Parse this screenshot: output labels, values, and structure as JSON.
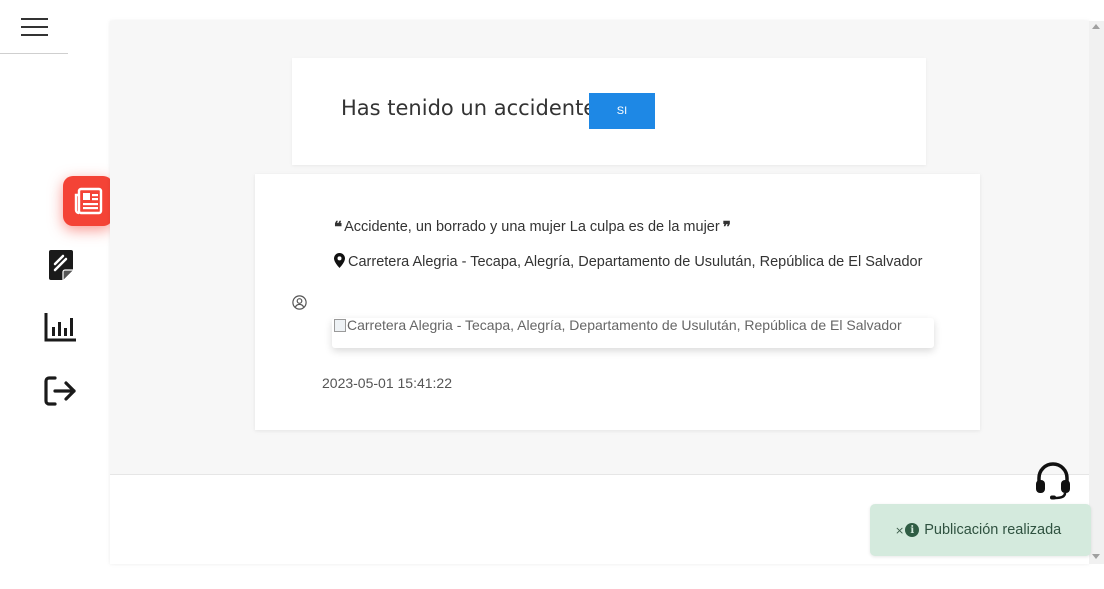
{
  "nav": {
    "menu_icon": "hamburger-icon",
    "items": [
      {
        "icon": "newspaper-icon",
        "active": true
      },
      {
        "icon": "edit-note-icon",
        "active": false
      },
      {
        "icon": "bar-chart-icon",
        "active": false
      },
      {
        "icon": "logout-icon",
        "active": false
      }
    ],
    "active_color": "#f44336"
  },
  "question": {
    "text": "Has tenido un accidente?",
    "button_label": "SI",
    "button_color": "#1e88e5"
  },
  "post": {
    "title": "Accidente, un borrado y una mujer La culpa es de la mujer",
    "location": "Carretera Alegria - Tecapa, Alegría, Departamento de Usulután, República de El Salvador",
    "image_alt": "Carretera Alegria - Tecapa, Alegría, Departamento de Usulután, República de El Salvador",
    "date": "2023-05-01 15:41:22",
    "user_icon": "user-circle-icon"
  },
  "support": {
    "icon": "headset-icon"
  },
  "toast": {
    "close": "×",
    "info": "i",
    "message": "Publicación realizada",
    "background": "#d4eadd"
  }
}
